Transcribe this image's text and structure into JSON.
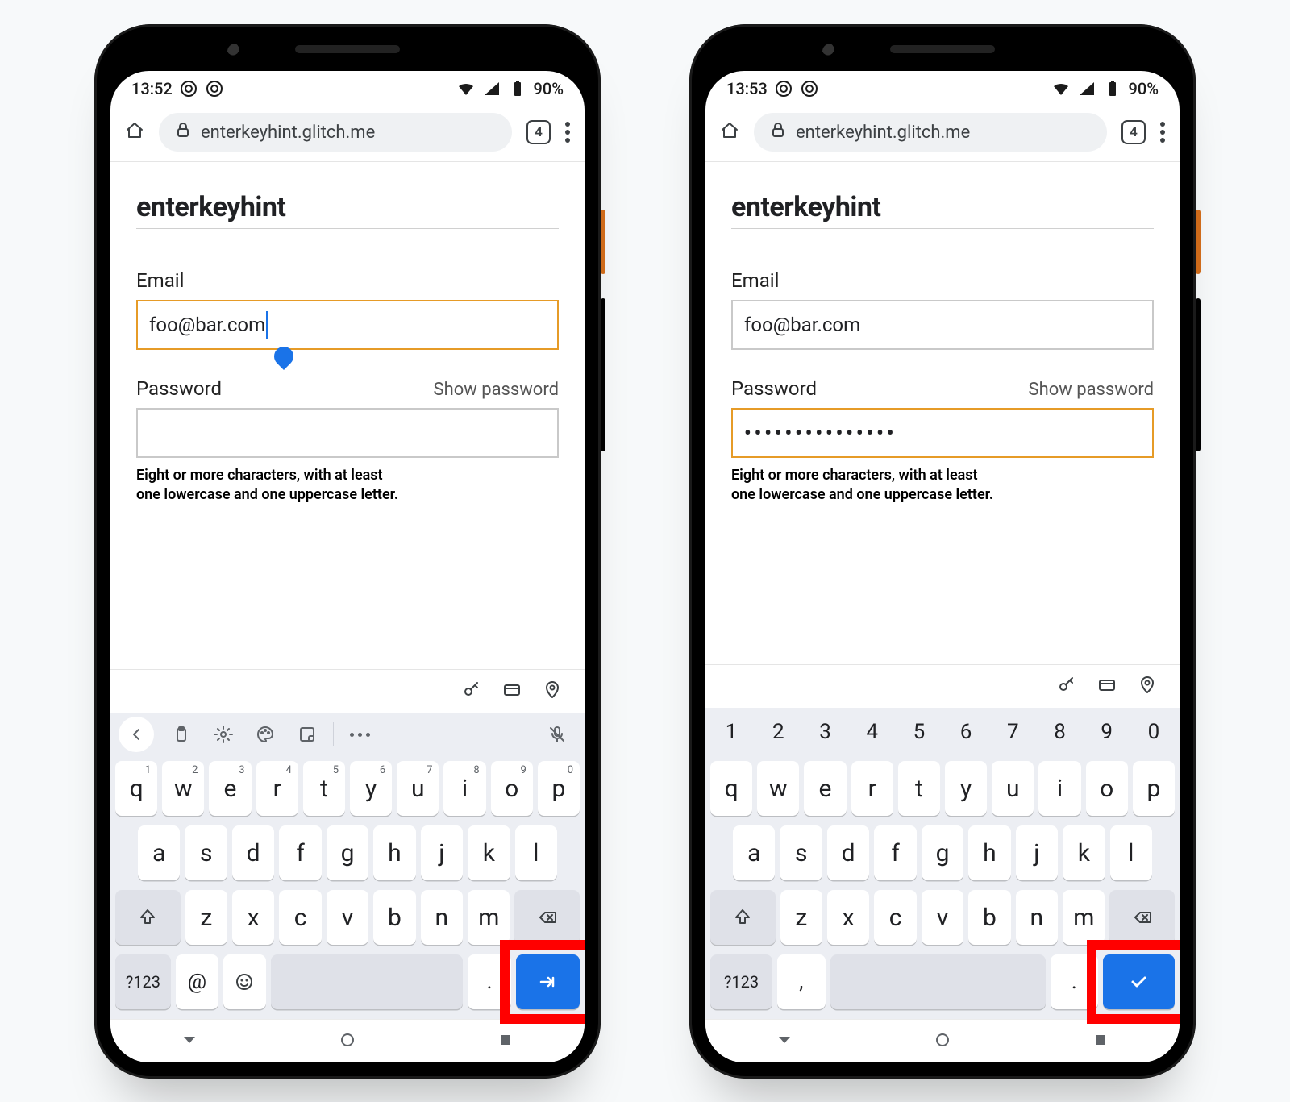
{
  "phones": [
    {
      "statusbar": {
        "time": "13:52",
        "battery_pct": "90%"
      },
      "omnibox": {
        "url": "enterkeyhint.glitch.me",
        "tab_count": "4"
      },
      "page": {
        "heading": "enterkeyhint",
        "email_label": "Email",
        "email_value": "foo@bar.com",
        "email_focused": true,
        "password_label": "Password",
        "show_password_label": "Show password",
        "password_value": "",
        "password_focused": false,
        "hint_line1": "Eight or more characters, with at least",
        "hint_line2": "one lowercase and one uppercase letter."
      },
      "keyboard": {
        "show_number_row": false,
        "show_gbar": true,
        "row1_sup": [
          "q:1",
          "w:2",
          "e:3",
          "r:4",
          "t:5",
          "y:6",
          "u:7",
          "i:8",
          "o:9",
          "p:0"
        ],
        "row2": [
          "a",
          "s",
          "d",
          "f",
          "g",
          "h",
          "j",
          "k",
          "l"
        ],
        "row3": [
          "z",
          "x",
          "c",
          "v",
          "b",
          "n",
          "m"
        ],
        "row4_mode": "?123",
        "row4_extra1": "@",
        "row4_extra2_icon": "emoji",
        "row4_period": ".",
        "enter_icon": "arrow-right"
      }
    },
    {
      "statusbar": {
        "time": "13:53",
        "battery_pct": "90%"
      },
      "omnibox": {
        "url": "enterkeyhint.glitch.me",
        "tab_count": "4"
      },
      "page": {
        "heading": "enterkeyhint",
        "email_label": "Email",
        "email_value": "foo@bar.com",
        "email_focused": false,
        "password_label": "Password",
        "show_password_label": "Show password",
        "password_value": "•••••••••••••••",
        "password_focused": true,
        "hint_line1": "Eight or more characters, with at least",
        "hint_line2": "one lowercase and one uppercase letter."
      },
      "keyboard": {
        "show_number_row": true,
        "show_gbar": false,
        "number_row": [
          "1",
          "2",
          "3",
          "4",
          "5",
          "6",
          "7",
          "8",
          "9",
          "0"
        ],
        "row1": [
          "q",
          "w",
          "e",
          "r",
          "t",
          "y",
          "u",
          "i",
          "o",
          "p"
        ],
        "row2": [
          "a",
          "s",
          "d",
          "f",
          "g",
          "h",
          "j",
          "k",
          "l"
        ],
        "row3": [
          "z",
          "x",
          "c",
          "v",
          "b",
          "n",
          "m"
        ],
        "row4_mode": "?123",
        "row4_extra1": ",",
        "row4_extra2_icon": null,
        "row4_period": ".",
        "enter_icon": "check"
      }
    }
  ]
}
